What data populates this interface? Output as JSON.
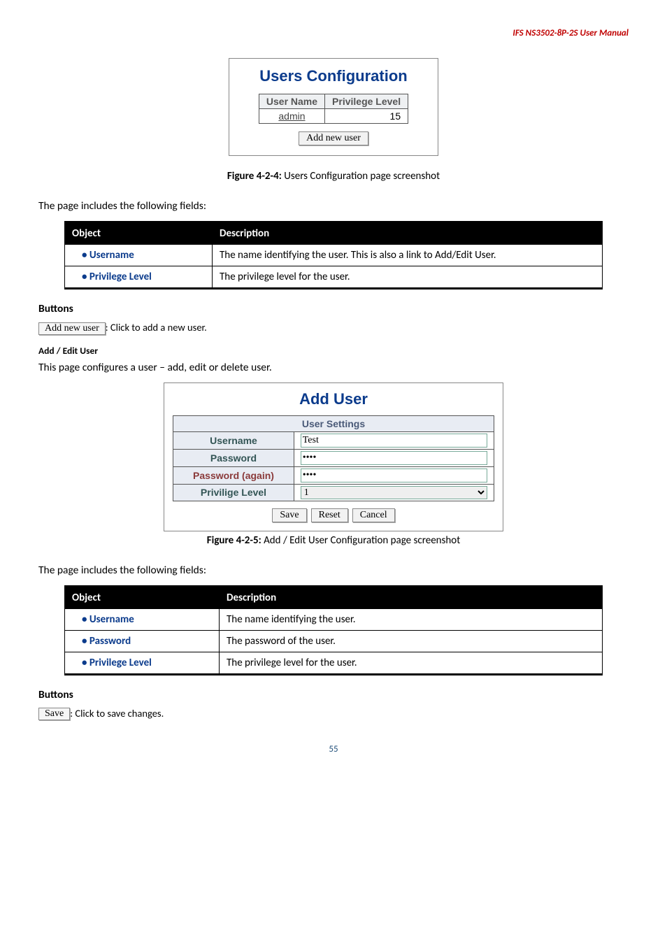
{
  "doc_header": "IFS  NS3502-8P-2S  User  Manual",
  "users_config": {
    "title": "Users Configuration",
    "col_name": "User Name",
    "col_level": "Privilege Level",
    "row_name": "admin",
    "row_level": "15",
    "add_btn": "Add new user"
  },
  "fig424_prefix": "Figure 4-2-4:",
  "fig424_text": " Users Configuration page screenshot",
  "includes_fields": "The page includes the following fields:",
  "headers": {
    "object": "Object",
    "description": "Description"
  },
  "table1": {
    "r1_obj": "Username",
    "r1_desc": "The name identifying the user. This is also a link to Add/Edit User.",
    "r2_obj": "Privilege Level",
    "r2_desc": "The privilege level for the user."
  },
  "buttons_label": "Buttons",
  "addnew_btn_inline": "Add new user",
  "addnew_desc": ": Click to add a new user.",
  "add_edit_heading": "Add / Edit User",
  "add_edit_intro": "This page configures a user – add, edit or delete user.",
  "add_user_panel": {
    "title": "Add User",
    "section": "User Settings",
    "l_username": "Username",
    "l_password": "Password",
    "l_password2": "Password (again)",
    "l_priv": "Privilige Level",
    "v_username": "Test",
    "v_password": "••••",
    "v_password2": "••••",
    "v_priv": "1",
    "btn_save": "Save",
    "btn_reset": "Reset",
    "btn_cancel": "Cancel"
  },
  "fig425_prefix": "Figure 4-2-5:",
  "fig425_text": " Add / Edit User Configuration page screenshot",
  "table2": {
    "r1_obj": "Username",
    "r1_desc": "The name identifying the user.",
    "r2_obj": "Password",
    "r2_desc": "The password of the user.",
    "r3_obj": "Privilege Level",
    "r3_desc": "The privilege level for the user."
  },
  "save_btn_inline": "Save",
  "save_desc": ": Click to save changes.",
  "page_num": "55"
}
